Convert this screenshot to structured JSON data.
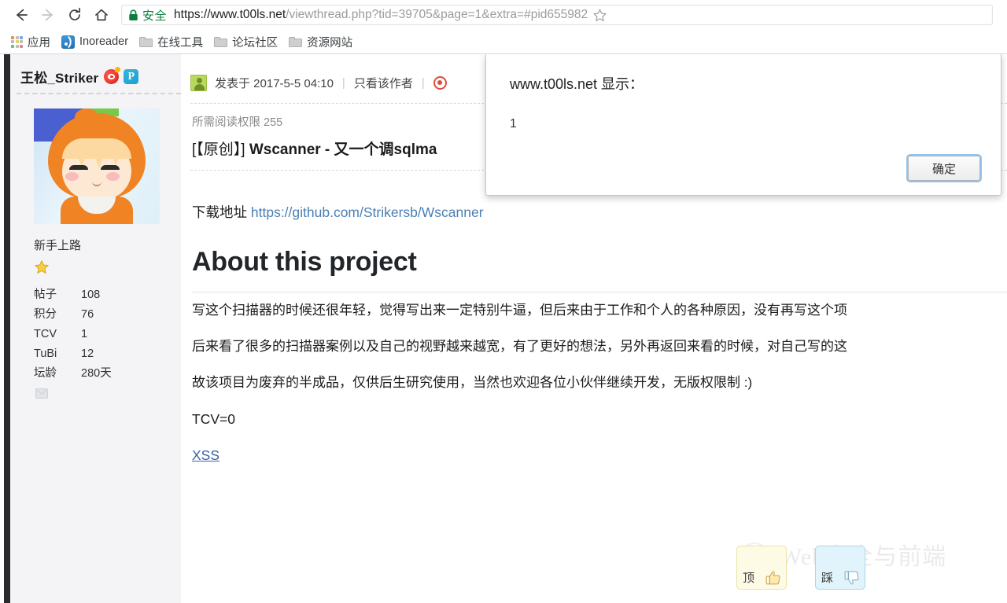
{
  "browser": {
    "nav": {
      "back": "back-arrow",
      "forward": "forward-arrow",
      "reload": "reload-icon",
      "home": "home-icon"
    },
    "omnibox": {
      "secure_label": "安全",
      "lock_icon": "lock-icon",
      "url_host": "https://www.t00ls.net",
      "url_path": "/viewthread.php?tid=39705&page=1&extra=#pid655982",
      "url_full": "https://www.t00ls.net/viewthread.php?tid=39705&page=1&extra=#pid655982",
      "bookmark_icon": "star-icon"
    },
    "bookmarks": [
      {
        "label": "应用",
        "icon": "apps-grid-icon"
      },
      {
        "label": "Inoreader",
        "icon": "rss-icon"
      },
      {
        "label": "在线工具",
        "icon": "folder-icon"
      },
      {
        "label": "论坛社区",
        "icon": "folder-icon"
      },
      {
        "label": "资源网站",
        "icon": "folder-icon"
      }
    ]
  },
  "dialog": {
    "title": "www.t00ls.net 显示：",
    "message": "1",
    "ok_label": "确定"
  },
  "sidebar": {
    "username": "王松_Striker",
    "badges": [
      "weibo-icon",
      "pinterest-icon"
    ],
    "avatar_alt": "anime-avatar",
    "rank": "新手上路",
    "star_badge": "star-icon",
    "stats": [
      {
        "key": "帖子",
        "value": "108"
      },
      {
        "key": "积分",
        "value": "76"
      },
      {
        "key": "TCV",
        "value": "1"
      },
      {
        "key": "TuBi",
        "value": "12"
      },
      {
        "key": "坛龄",
        "value": "280天"
      }
    ],
    "mini_icon": "message-icon"
  },
  "post": {
    "posted_label": "发表于 2017-5-5 04:10",
    "only_author": "只看该作者",
    "read_permission": "所需阅读权限 255",
    "title_tag": "[【原创】]",
    "title_text": "Wscanner - 又一个调sqlma",
    "download_label": "下载地址",
    "download_url": "https://github.com/Strikersb/Wscanner",
    "heading": "About this project",
    "paragraphs": [
      "写这个扫描器的时候还很年轻，觉得写出来一定特别牛逼，但后来由于工作和个人的各种原因，没有再写这个项",
      "后来看了很多的扫描器案例以及自己的视野越来越宽，有了更好的想法，另外再返回来看的时候，对自己写的这",
      "故该项目为废弃的半成品，仅供后生研究使用，当然也欢迎各位小伙伴继续开发，无版权限制 :)"
    ],
    "tcv_line": "TCV=0",
    "xss_link": "XSS"
  },
  "votes": {
    "up_label": "顶",
    "down_label": "踩",
    "up_icon": "thumbs-up-icon",
    "down_icon": "thumbs-down-icon"
  },
  "watermark": {
    "text": "Web安全与前端",
    "icon": "wechat-icon"
  },
  "colors": {
    "secure_green": "#0b7e3e",
    "link_blue": "#4a7fb5",
    "xss_blue": "#3a5fa8",
    "focus_ring": "#8fc4ef",
    "vote_up_bg": "#fdfbe5",
    "vote_down_bg": "#e2f4fb",
    "sidebar_bg": "#f4f4f7"
  }
}
